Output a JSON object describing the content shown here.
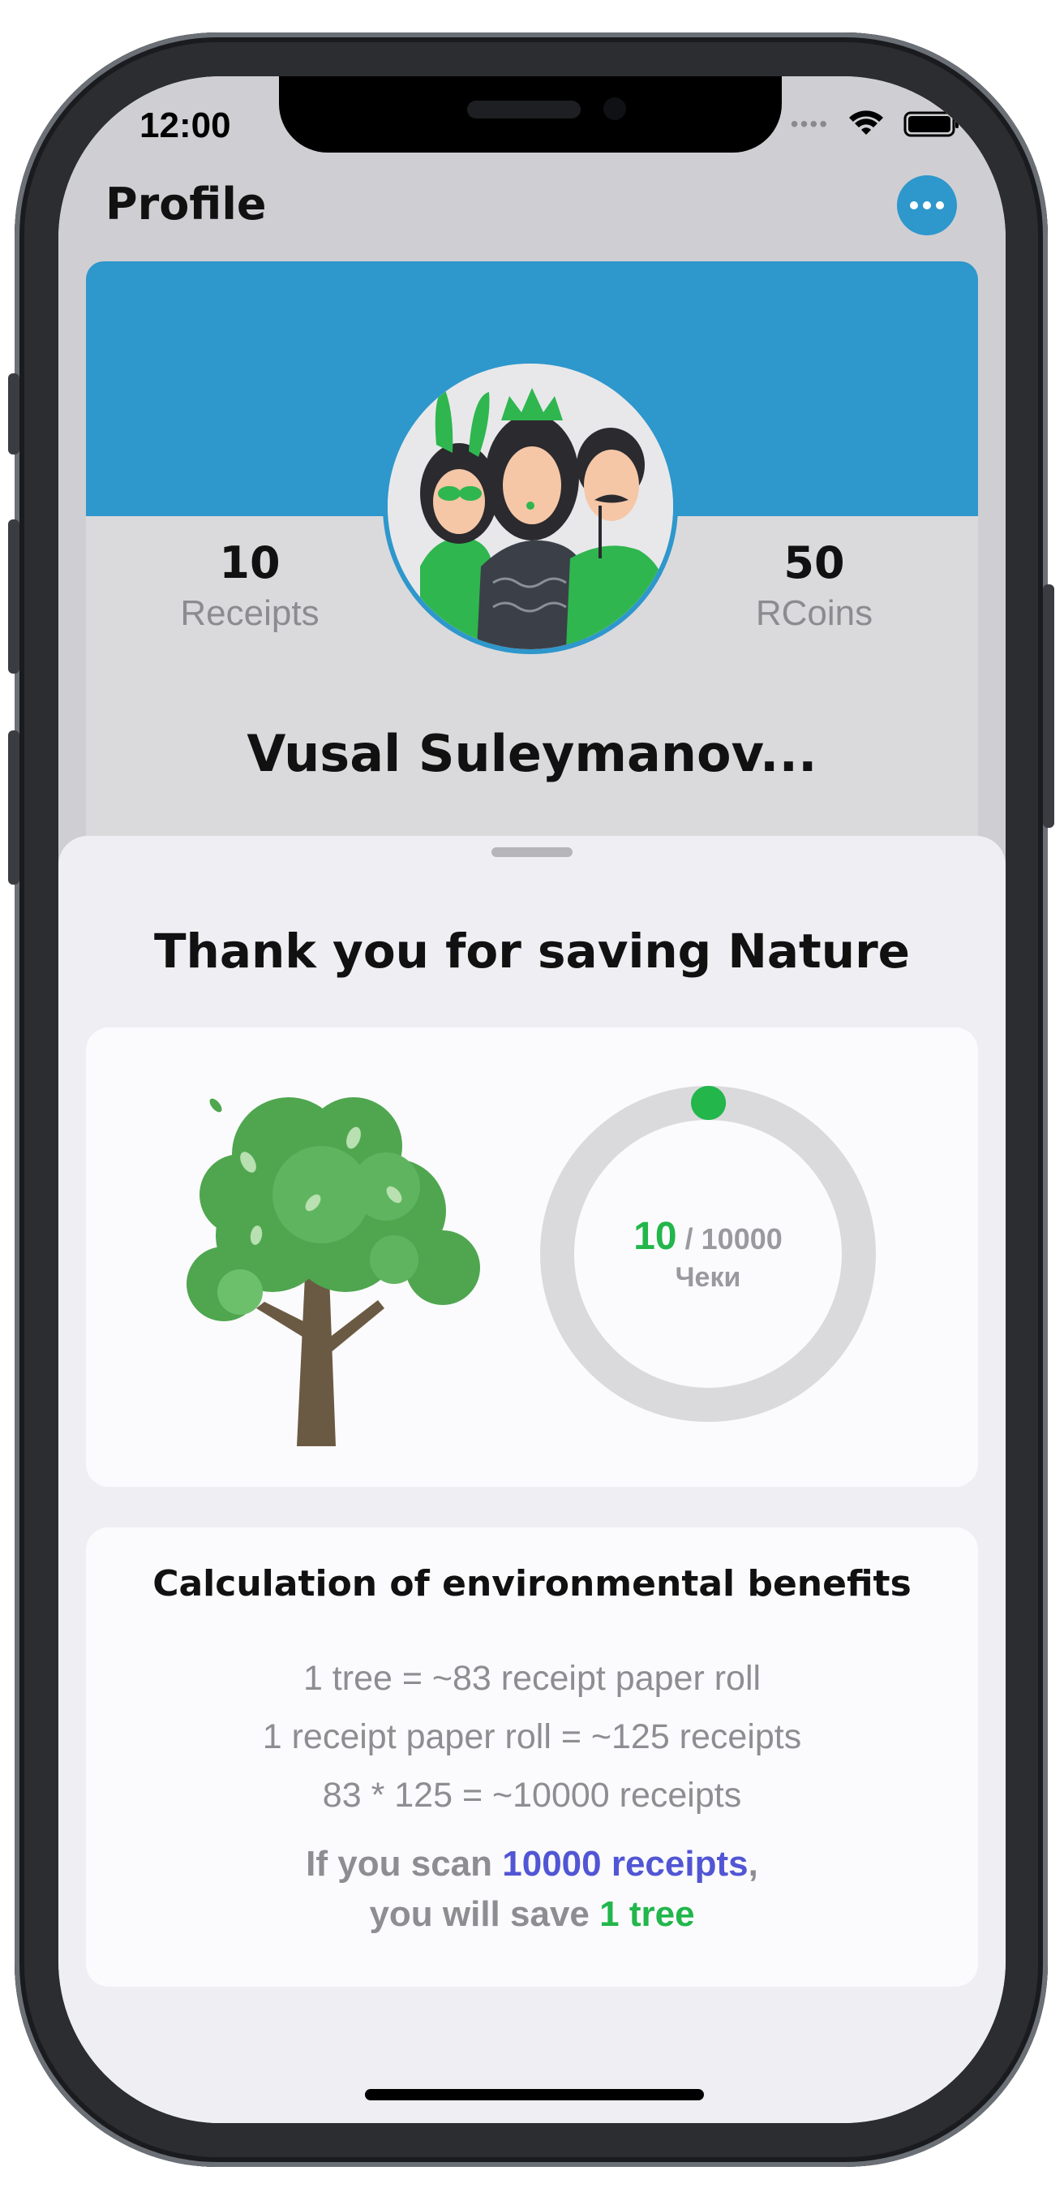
{
  "status_bar": {
    "time": "12:00"
  },
  "header": {
    "title": "Profile"
  },
  "profile": {
    "receipts_count": "10",
    "receipts_label": "Receipts",
    "rcoins_count": "50",
    "rcoins_label": "RCoins",
    "name": "Vusal Suleymanov..."
  },
  "sheet": {
    "title": "Thank you for saving Nature",
    "progress": {
      "current": "10",
      "total": "/ 10000",
      "unit": "Чеки",
      "fraction": 0.001
    },
    "calc": {
      "title": "Calculation of environmental benefits",
      "lines": [
        "1 tree = ~83 receipt paper roll",
        "1 receipt paper roll = ~125 receipts",
        "83 * 125 = ~10000 receipts"
      ],
      "footer": {
        "line1_prefix": "If you scan ",
        "line1_highlight": "10000 receipts",
        "line1_suffix": ",",
        "line2_prefix": "you will save ",
        "line2_highlight": "1 tree"
      }
    }
  },
  "colors": {
    "accent": "#2e97cc",
    "green": "#22b64b",
    "purple": "#5156d4"
  }
}
